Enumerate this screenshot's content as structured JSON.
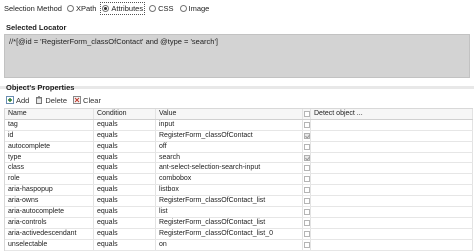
{
  "selection_method": {
    "label": "Selection Method",
    "options": [
      {
        "label": "XPath",
        "selected": false
      },
      {
        "label": "Attributes",
        "selected": true
      },
      {
        "label": "CSS",
        "selected": false
      },
      {
        "label": "Image",
        "selected": false
      }
    ]
  },
  "selected_locator": {
    "title": "Selected Locator",
    "value": "//*[@id = 'RegisterForm_classOfContact' and @type = 'search']"
  },
  "properties": {
    "title": "Object's Properties",
    "toolbar": {
      "add_label": "Add",
      "delete_label": "Delete",
      "clear_label": "Clear"
    },
    "columns": {
      "name": "Name",
      "condition": "Condition",
      "value": "Value",
      "detect": "Detect object ..."
    },
    "rows": [
      {
        "name": "tag",
        "condition": "equals",
        "value": "input",
        "checked": false
      },
      {
        "name": "id",
        "condition": "equals",
        "value": "RegisterForm_classOfContact",
        "checked": true
      },
      {
        "name": "autocomplete",
        "condition": "equals",
        "value": "off",
        "checked": false
      },
      {
        "name": "type",
        "condition": "equals",
        "value": "search",
        "checked": true
      },
      {
        "name": "class",
        "condition": "equals",
        "value": "ant-select-selection-search-input",
        "checked": false
      },
      {
        "name": "role",
        "condition": "equals",
        "value": "combobox",
        "checked": false
      },
      {
        "name": "aria-haspopup",
        "condition": "equals",
        "value": "listbox",
        "checked": false
      },
      {
        "name": "aria-owns",
        "condition": "equals",
        "value": "RegisterForm_classOfContact_list",
        "checked": false
      },
      {
        "name": "aria-autocomplete",
        "condition": "equals",
        "value": "list",
        "checked": false
      },
      {
        "name": "aria-controls",
        "condition": "equals",
        "value": "RegisterForm_classOfContact_list",
        "checked": false
      },
      {
        "name": "aria-activedescendant",
        "condition": "equals",
        "value": "RegisterForm_classOfContact_list_0",
        "checked": false
      },
      {
        "name": "unselectable",
        "condition": "equals",
        "value": "on",
        "checked": false
      }
    ]
  }
}
